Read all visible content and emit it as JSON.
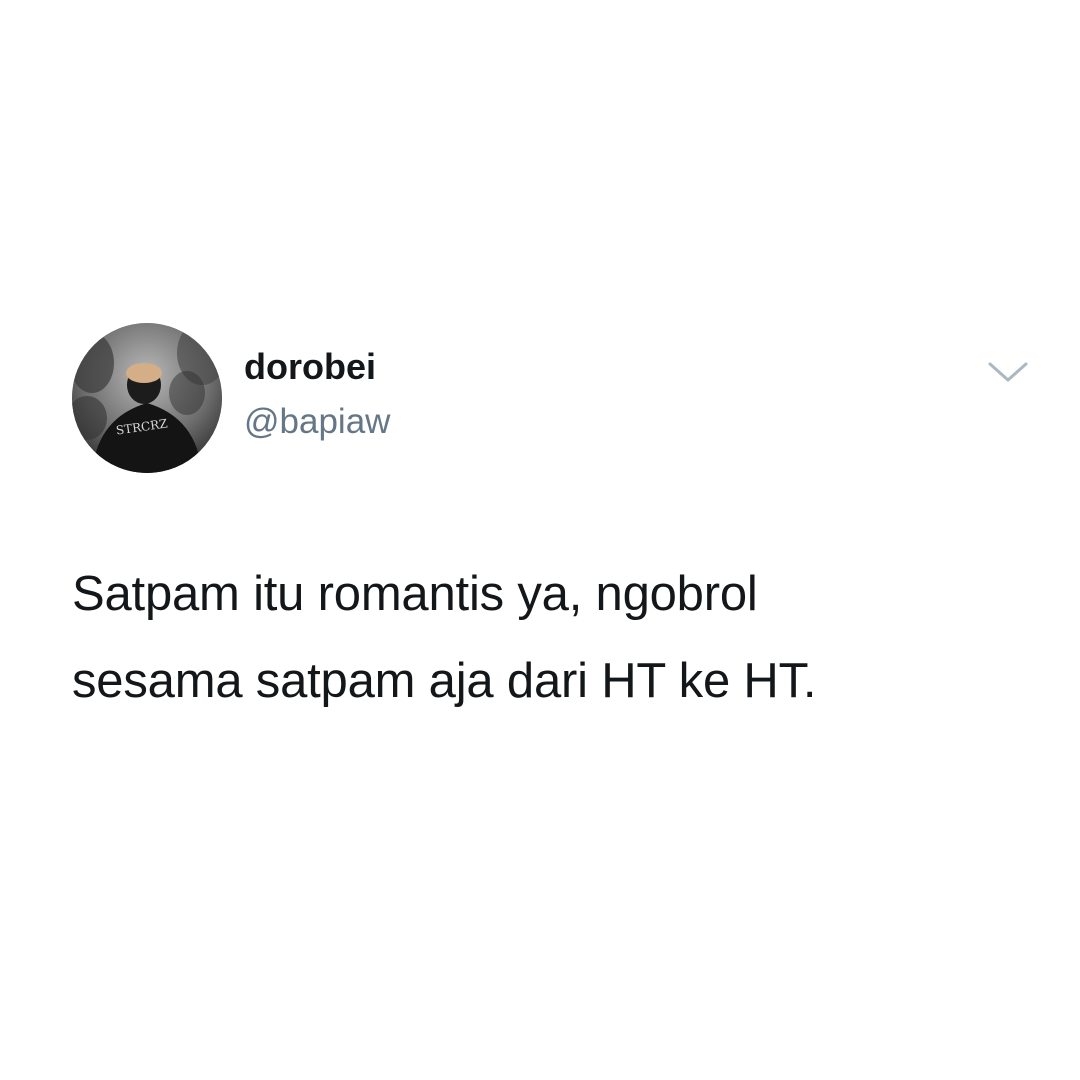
{
  "tweet": {
    "display_name": "dorobei",
    "handle": "@bapiaw",
    "text_lines": [
      "Satpam itu romantis ya, ngobrol",
      "sesama satpam aja dari HT ke HT."
    ],
    "avatar": {
      "icon": "profile-photo",
      "jacket_text": "STRCRZ"
    },
    "menu_icon": "chevron-down-icon"
  },
  "colors": {
    "background": "#ffffff",
    "text_primary": "#14171a",
    "text_secondary": "#657786",
    "chevron": "#aab8c2"
  }
}
